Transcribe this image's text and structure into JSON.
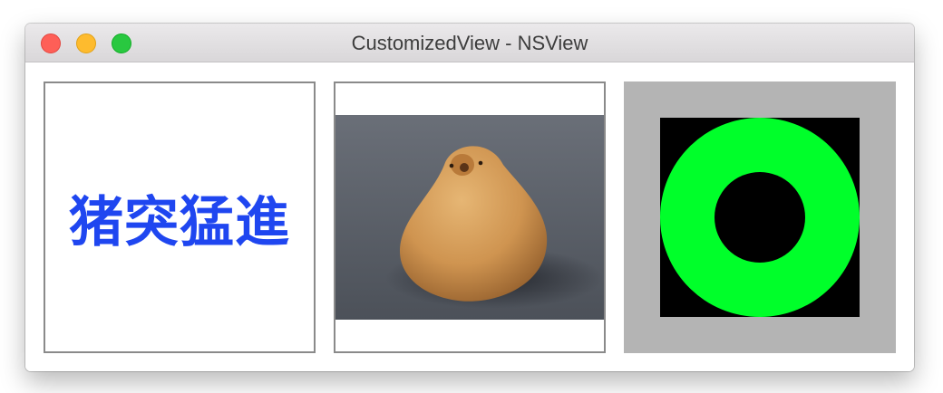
{
  "window": {
    "title": "CustomizedView - NSView",
    "controls": [
      "close-button",
      "minimize-button",
      "zoom-button"
    ]
  },
  "panels": {
    "text_panel": {
      "text": "猪突猛進",
      "text_color": "#1f46f0"
    },
    "image_panel": {
      "subject": "bird-shaped-cookie-photo"
    },
    "ring_panel": {
      "background": "#b4b4b4",
      "square_color": "#000000",
      "ring_color": "#00ff2a"
    }
  },
  "colors": {
    "close": "#fe5f57",
    "minimize": "#febb2e",
    "zoom": "#29c840"
  }
}
